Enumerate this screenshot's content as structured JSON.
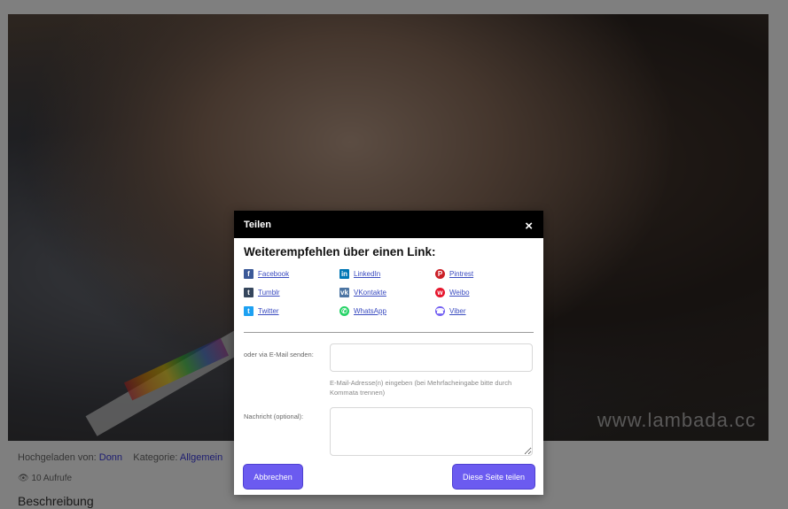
{
  "background": {
    "watermark": "www.lambada.cc",
    "meta": {
      "uploaded_label": "Hochgeladen von:",
      "uploader": "Donn",
      "category_label": "Kategorie:",
      "category": "Allgemein"
    },
    "views": "10 Aufrufe",
    "description_heading": "Beschreibung"
  },
  "modal": {
    "title": "Teilen",
    "close_label": "×",
    "section_title": "Weiterempfehlen über einen Link:",
    "links": [
      {
        "label": "Facebook",
        "icon": "facebook-icon",
        "glyph": "f",
        "color": "#3b5998"
      },
      {
        "label": "LinkedIn",
        "icon": "linkedin-icon",
        "glyph": "in",
        "color": "#0077b5"
      },
      {
        "label": "Pintrest",
        "icon": "pinterest-icon",
        "glyph": "P",
        "color": "#cb2027"
      },
      {
        "label": "Tumblr",
        "icon": "tumblr-icon",
        "glyph": "t",
        "color": "#35465c"
      },
      {
        "label": "VKontakte",
        "icon": "vkontakte-icon",
        "glyph": "vk",
        "color": "#4c75a3"
      },
      {
        "label": "Weibo",
        "icon": "weibo-icon",
        "glyph": "w",
        "color": "#e6162d"
      },
      {
        "label": "Twitter",
        "icon": "twitter-icon",
        "glyph": "t",
        "color": "#1da1f2"
      },
      {
        "label": "WhatsApp",
        "icon": "whatsapp-icon",
        "glyph": "✆",
        "color": "#25d366"
      },
      {
        "label": "Viber",
        "icon": "viber-icon",
        "glyph": "☎",
        "color": "#7360f2"
      }
    ],
    "email_label": "oder via E-Mail senden:",
    "email_value": "",
    "email_hint": "E-Mail-Adresse(n) eingeben (bei Mehrfacheingabe bitte durch Kommata trennen)",
    "message_label": "Nachricht (optional):",
    "message_value": "",
    "cancel_label": "Abbrechen",
    "share_label": "Diese Seite teilen",
    "accent_color": "#6b5bf0"
  }
}
